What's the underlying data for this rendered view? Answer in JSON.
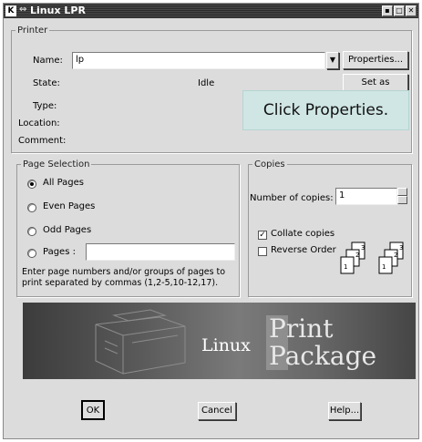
{
  "window": {
    "title": "Linux LPR",
    "icon": "kde-k-icon",
    "buttons": [
      "minimize",
      "maximize",
      "close"
    ]
  },
  "printer_group": {
    "legend": "Printer",
    "name_label": "Name:",
    "name_value": "lp",
    "properties_button": "Properties...",
    "state_label": "State:",
    "state_value": "Idle",
    "set_default_button": "Set as Default",
    "type_label": "Type:",
    "location_label": "Location:",
    "comment_label": "Comment:"
  },
  "tooltip": {
    "text": "Click Properties."
  },
  "page_selection": {
    "legend": "Page Selection",
    "options": [
      {
        "label": "All Pages",
        "selected": true
      },
      {
        "label": "Even Pages",
        "selected": false
      },
      {
        "label": "Odd Pages",
        "selected": false
      },
      {
        "label": "Pages :",
        "selected": false
      }
    ],
    "pages_value": "",
    "hint": "Enter page numbers and/or groups of pages to print separated by commas (1,2-5,10-12,17)."
  },
  "copies": {
    "legend": "Copies",
    "number_label": "Number of copies:",
    "number_value": "1",
    "collate_label": "Collate copies",
    "collate_checked": true,
    "reverse_label": "Reverse Order",
    "reverse_checked": false,
    "collate_icon_numbers": [
      "3",
      "2",
      "1",
      "3",
      "2",
      "1"
    ]
  },
  "banner": {
    "linux": "Linux",
    "print": "Print",
    "package": "Package"
  },
  "footer": {
    "ok": "OK",
    "cancel": "Cancel",
    "help": "Help..."
  }
}
